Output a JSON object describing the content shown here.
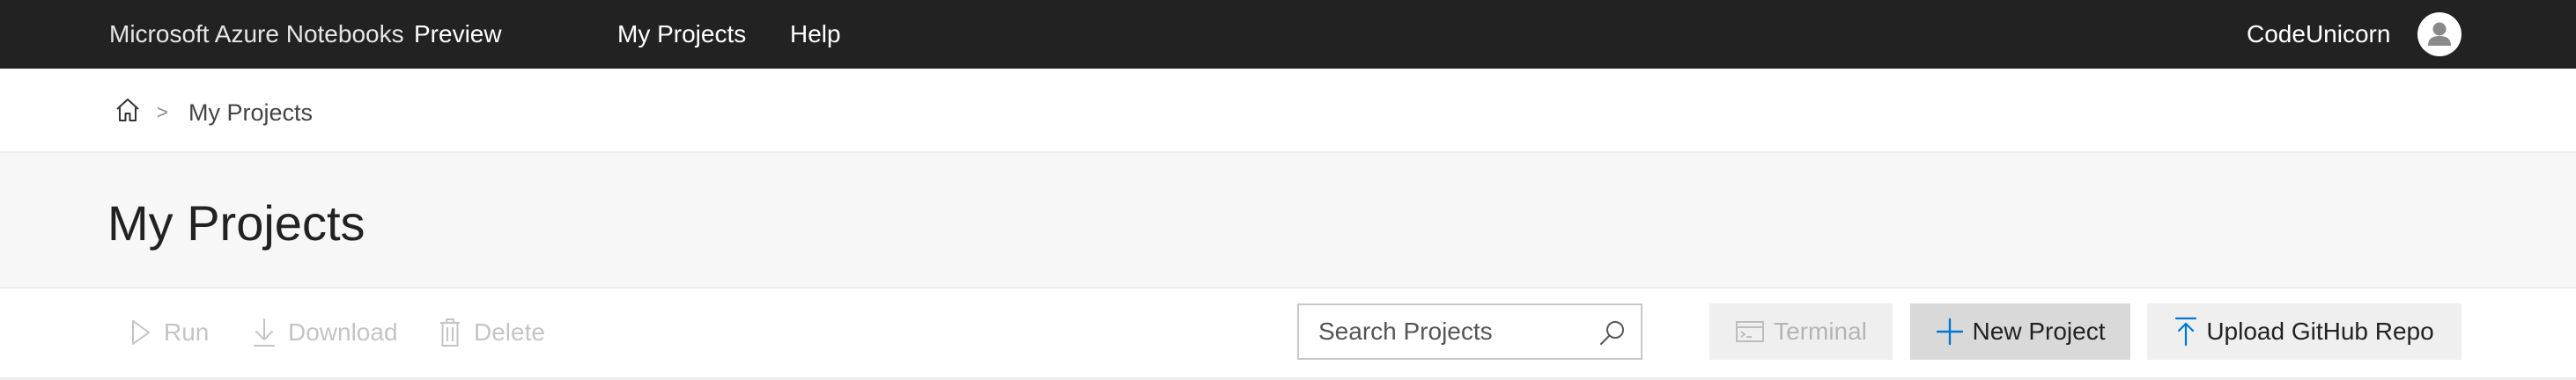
{
  "header": {
    "brand": "Microsoft Azure Notebooks",
    "preview": "Preview",
    "nav": [
      {
        "label": "My Projects"
      },
      {
        "label": "Help"
      }
    ],
    "username": "CodeUnicorn",
    "avatar_icon": "user-avatar-icon",
    "background_color": "#222222"
  },
  "breadcrumb": {
    "home_icon": "home-icon",
    "separator": ">",
    "current": "My Projects"
  },
  "page": {
    "title": "My Projects"
  },
  "toolbar": {
    "run": {
      "label": "Run",
      "icon": "play-icon",
      "enabled": false
    },
    "download": {
      "label": "Download",
      "icon": "download-icon",
      "enabled": false
    },
    "delete": {
      "label": "Delete",
      "icon": "trash-icon",
      "enabled": false
    },
    "search": {
      "placeholder": "Search Projects",
      "value": "",
      "icon": "search-icon"
    },
    "terminal": {
      "label": "Terminal",
      "icon": "terminal-icon",
      "enabled": false
    },
    "new_project": {
      "label": "New Project",
      "icon": "plus-icon",
      "enabled": true
    },
    "upload": {
      "label": "Upload GitHub Repo",
      "icon": "upload-icon",
      "enabled": true
    },
    "accent_color": "#0078d4"
  }
}
